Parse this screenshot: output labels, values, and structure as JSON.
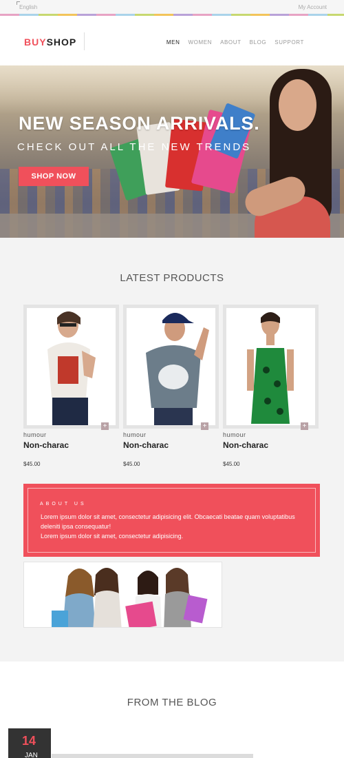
{
  "topbar": {
    "language": "English",
    "account": "My Account"
  },
  "header": {
    "logo_buy": "BUY",
    "logo_shop": "SHOP",
    "nav": [
      "MEN",
      "WOMEN",
      "ABOUT",
      "BLOG",
      "SUPPORT"
    ]
  },
  "hero": {
    "title": "NEW SEASON ARRIVALS.",
    "subtitle": "CHECK OUT ALL THE NEW TRENDS",
    "button": "SHOP NOW"
  },
  "latest": {
    "title": "LATEST PRODUCTS",
    "products": [
      {
        "category": "humour",
        "name": "Non-charac",
        "price": "$45.00"
      },
      {
        "category": "humour",
        "name": "Non-charac",
        "price": "$45.00"
      },
      {
        "category": "humour",
        "name": "Non-charac",
        "price": "$45.00"
      }
    ]
  },
  "about": {
    "heading": "ABOUT US",
    "line1": "Lorem ipsum dolor sit amet, consectetur adipisicing elit. Obcaecati beatae quam voluptatibus deleniti ipsa consequatur!",
    "line2": "Lorem ipsum dolor sit amet, consectetur adipisicing."
  },
  "blog": {
    "title": "FROM THE BLOG",
    "day": "14",
    "month": "JAN"
  },
  "colors": {
    "accent": "#f0505b",
    "dark": "#333333"
  }
}
